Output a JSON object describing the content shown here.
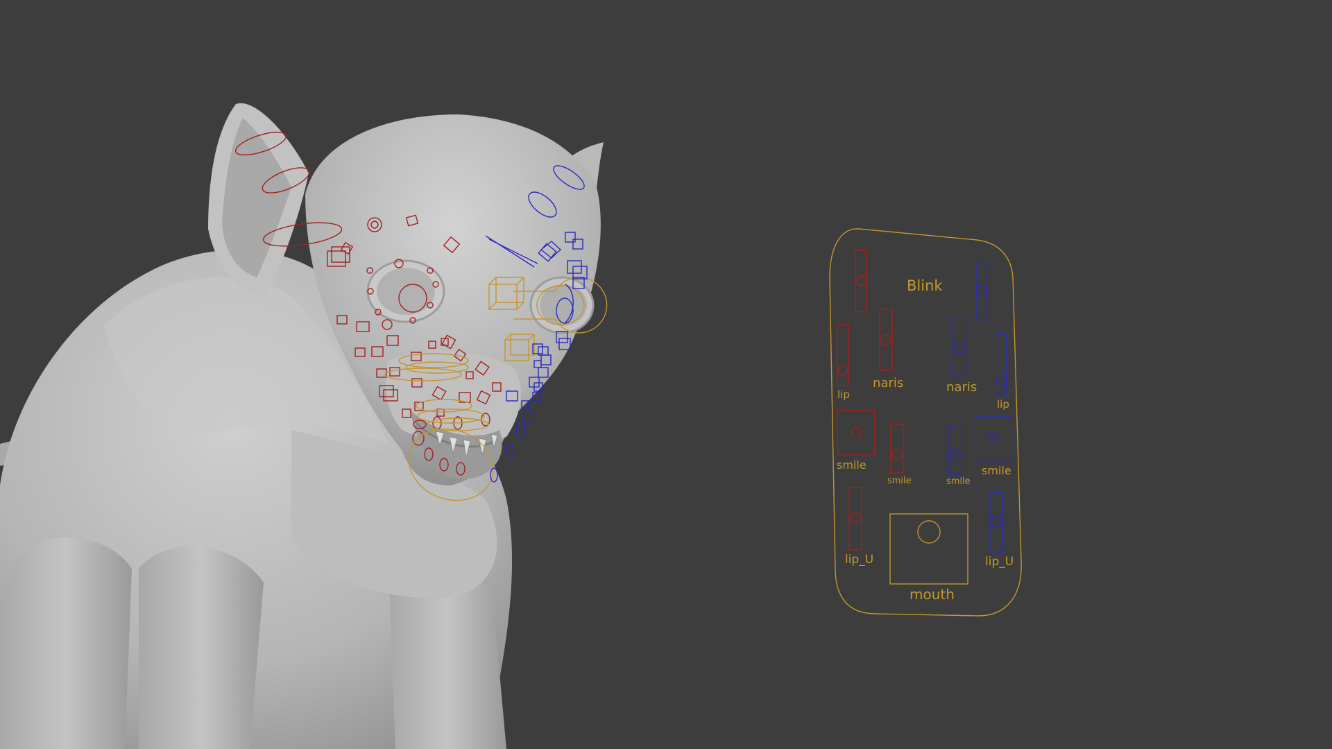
{
  "viewport": {
    "background": "#3d3d3d"
  },
  "colors": {
    "left_side": "#a32020",
    "right_side": "#2a2ac0",
    "center": "#c4962d",
    "label": "#c59a2b",
    "mesh": "#b8b8b8"
  },
  "face_panel": {
    "labels": {
      "blink": "Blink",
      "naris_l": "naris",
      "naris_r": "naris",
      "lip_l": "lip",
      "lip_r": "lip",
      "smile_l": "smile",
      "smile_l_small": "smile",
      "smile_r_small": "smile",
      "smile_r": "smile",
      "lip_u_l": "lip_U",
      "lip_u_r": "lip_U",
      "mouth": "mouth"
    }
  }
}
